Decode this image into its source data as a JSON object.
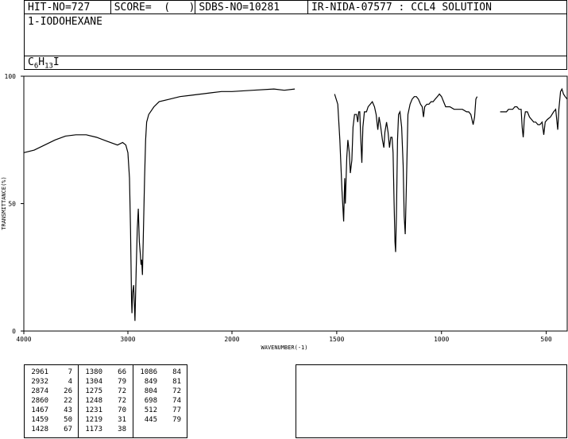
{
  "header": {
    "hit_no": "HIT-NO=727",
    "score": "SCORE=  (   )",
    "sdbs_no": "SDBS-NO=10281",
    "ir_nida": "IR-NIDA-07577 : CCL4 SOLUTION"
  },
  "compound_name": "1-IODOHEXANE",
  "formula": {
    "c": "C",
    "c_n": "6",
    "h": "H",
    "h_n": "13",
    "rest": "I"
  },
  "peak_table": [
    [
      [
        "2961",
        "7"
      ],
      [
        "2932",
        "4"
      ],
      [
        "2874",
        "26"
      ],
      [
        "2860",
        "22"
      ],
      [
        "1467",
        "43"
      ],
      [
        "1459",
        "50"
      ],
      [
        "1428",
        "67"
      ]
    ],
    [
      [
        "1380",
        "66"
      ],
      [
        "1304",
        "79"
      ],
      [
        "1275",
        "72"
      ],
      [
        "1248",
        "72"
      ],
      [
        "1231",
        "70"
      ],
      [
        "1219",
        "31"
      ],
      [
        "1173",
        "38"
      ]
    ],
    [
      [
        "1086",
        "84"
      ],
      [
        "849",
        "81"
      ],
      [
        "804",
        "72"
      ],
      [
        "698",
        "74"
      ],
      [
        "512",
        "77"
      ],
      [
        "445",
        "79"
      ]
    ]
  ],
  "chart_data": {
    "type": "line",
    "xlabel": "WAVENUMBER(-1)",
    "ylabel": "TRANSMITTANCE(%)",
    "xlim": [
      4000,
      400
    ],
    "ylim": [
      0,
      100
    ],
    "x_ticks": [
      4000,
      3000,
      2000,
      1500,
      1000,
      500
    ],
    "y_ticks": [
      0,
      50,
      100
    ],
    "grid": false,
    "series": [
      {
        "points": [
          [
            4000,
            70
          ],
          [
            3900,
            71
          ],
          [
            3800,
            73
          ],
          [
            3700,
            75
          ],
          [
            3600,
            76.5
          ],
          [
            3500,
            77
          ],
          [
            3400,
            77
          ],
          [
            3300,
            76
          ],
          [
            3200,
            74.5
          ],
          [
            3100,
            73
          ],
          [
            3050,
            74
          ],
          [
            3020,
            73
          ],
          [
            3000,
            70
          ],
          [
            2985,
            60
          ],
          [
            2975,
            40
          ],
          [
            2965,
            12
          ],
          [
            2961,
            7
          ],
          [
            2955,
            15
          ],
          [
            2945,
            18
          ],
          [
            2932,
            4
          ],
          [
            2920,
            25
          ],
          [
            2910,
            40
          ],
          [
            2900,
            48
          ],
          [
            2890,
            35
          ],
          [
            2880,
            30
          ],
          [
            2874,
            26
          ],
          [
            2868,
            28
          ],
          [
            2860,
            22
          ],
          [
            2850,
            40
          ],
          [
            2840,
            60
          ],
          [
            2830,
            75
          ],
          [
            2820,
            82
          ],
          [
            2800,
            85
          ],
          [
            2750,
            88
          ],
          [
            2700,
            90
          ],
          [
            2600,
            91
          ],
          [
            2500,
            92
          ],
          [
            2400,
            92.5
          ],
          [
            2300,
            93
          ],
          [
            2200,
            93.5
          ],
          [
            2100,
            94
          ],
          [
            2000,
            94
          ],
          [
            1900,
            94.5
          ],
          [
            1800,
            95
          ],
          [
            1750,
            94.5
          ],
          [
            1700,
            95
          ]
        ],
        "segment_end": true
      },
      {
        "points": [
          [
            1510,
            93
          ],
          [
            1495,
            89
          ],
          [
            1485,
            75
          ],
          [
            1475,
            55
          ],
          [
            1467,
            43
          ],
          [
            1462,
            60
          ],
          [
            1459,
            50
          ],
          [
            1452,
            68
          ],
          [
            1447,
            75
          ],
          [
            1440,
            70
          ],
          [
            1435,
            62
          ],
          [
            1428,
            67
          ],
          [
            1422,
            80
          ],
          [
            1415,
            85
          ],
          [
            1405,
            85
          ],
          [
            1400,
            82
          ],
          [
            1395,
            86
          ],
          [
            1390,
            86
          ],
          [
            1385,
            75
          ],
          [
            1380,
            66
          ],
          [
            1375,
            80
          ],
          [
            1368,
            86
          ],
          [
            1358,
            86
          ],
          [
            1350,
            88
          ],
          [
            1340,
            89
          ],
          [
            1330,
            90
          ],
          [
            1320,
            88
          ],
          [
            1312,
            85
          ],
          [
            1304,
            79
          ],
          [
            1298,
            84
          ],
          [
            1290,
            80
          ],
          [
            1282,
            75
          ],
          [
            1275,
            72
          ],
          [
            1270,
            78
          ],
          [
            1262,
            82
          ],
          [
            1255,
            78
          ],
          [
            1248,
            72
          ],
          [
            1242,
            76
          ],
          [
            1236,
            76
          ],
          [
            1231,
            70
          ],
          [
            1226,
            50
          ],
          [
            1222,
            35
          ],
          [
            1219,
            31
          ],
          [
            1215,
            45
          ],
          [
            1210,
            75
          ],
          [
            1205,
            85
          ],
          [
            1198,
            86
          ],
          [
            1190,
            80
          ],
          [
            1183,
            65
          ],
          [
            1178,
            45
          ],
          [
            1173,
            38
          ],
          [
            1168,
            55
          ],
          [
            1160,
            85
          ],
          [
            1150,
            89
          ],
          [
            1140,
            91
          ],
          [
            1130,
            92
          ],
          [
            1120,
            92
          ],
          [
            1110,
            91
          ],
          [
            1100,
            89
          ],
          [
            1092,
            88
          ],
          [
            1086,
            84
          ],
          [
            1080,
            88
          ],
          [
            1070,
            89
          ],
          [
            1060,
            89
          ],
          [
            1050,
            90
          ],
          [
            1040,
            90
          ],
          [
            1030,
            91
          ],
          [
            1020,
            92
          ],
          [
            1010,
            93
          ],
          [
            1000,
            92
          ],
          [
            990,
            90
          ],
          [
            980,
            88
          ],
          [
            960,
            88
          ],
          [
            940,
            87
          ],
          [
            920,
            87
          ],
          [
            900,
            87
          ],
          [
            880,
            86
          ],
          [
            870,
            86
          ],
          [
            860,
            85
          ],
          [
            849,
            81
          ],
          [
            842,
            84
          ],
          [
            836,
            91
          ],
          [
            830,
            92
          ]
        ]
      },
      {
        "points": [
          [
            720,
            86
          ],
          [
            700,
            86
          ],
          [
            690,
            86
          ],
          [
            680,
            87
          ],
          [
            670,
            87
          ],
          [
            660,
            87
          ],
          [
            650,
            88
          ],
          [
            640,
            88
          ],
          [
            630,
            87
          ],
          [
            620,
            87
          ],
          [
            615,
            80
          ],
          [
            610,
            76
          ],
          [
            608,
            78
          ],
          [
            605,
            83
          ],
          [
            600,
            86
          ],
          [
            590,
            86
          ],
          [
            580,
            84
          ],
          [
            570,
            83
          ],
          [
            560,
            82
          ],
          [
            550,
            82
          ],
          [
            540,
            81
          ],
          [
            530,
            81
          ],
          [
            520,
            82
          ],
          [
            512,
            77
          ],
          [
            505,
            82
          ],
          [
            495,
            83
          ],
          [
            480,
            84
          ],
          [
            465,
            86
          ],
          [
            455,
            87
          ],
          [
            445,
            79
          ],
          [
            440,
            87
          ],
          [
            432,
            94
          ],
          [
            425,
            95
          ],
          [
            418,
            93
          ],
          [
            410,
            92
          ],
          [
            400,
            91
          ]
        ]
      }
    ]
  }
}
